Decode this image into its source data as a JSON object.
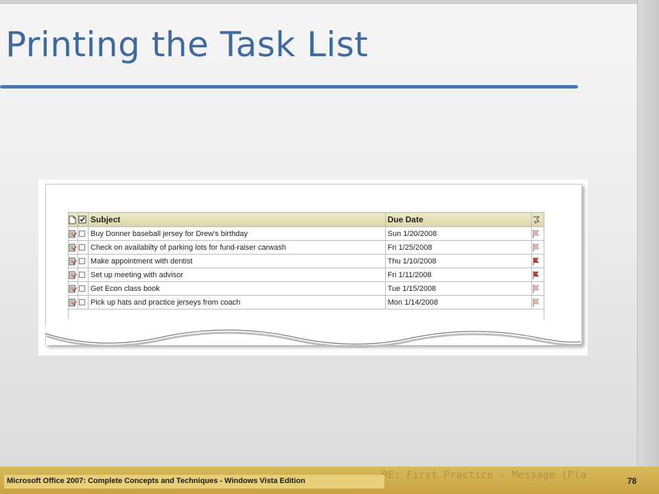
{
  "slide": {
    "title": "Printing the Task List",
    "footer": "Microsoft Office 2007: Complete Concepts and Techniques - Windows Vista Edition",
    "slide_number": "78",
    "footer_ghost_caption": "RE: First Practice - Message (Plain Te",
    "accent_color": "#3f6a9b",
    "footer_color": "#d4b052"
  },
  "task_table": {
    "columns": {
      "subject": "Subject",
      "due_date": "Due Date"
    },
    "rows": [
      {
        "subject": "Buy Donner baseball jersey for Drew's birthday",
        "due": "Sun 1/20/2008",
        "flag": "light"
      },
      {
        "subject": "Check on availabilty of parking lots for fund-raiser carwash",
        "due": "Fri 1/25/2008",
        "flag": "light"
      },
      {
        "subject": "Make appointment with dentist",
        "due": "Thu 1/10/2008",
        "flag": "dark"
      },
      {
        "subject": "Set up meeting with advisor",
        "due": "Fri 1/11/2008",
        "flag": "dark"
      },
      {
        "subject": "Get Econ class book",
        "due": "Tue 1/15/2008",
        "flag": "light"
      },
      {
        "subject": "Pick up hats and practice jerseys from coach",
        "due": "Mon 1/14/2008",
        "flag": "light"
      }
    ]
  },
  "icons": {
    "header": [
      "document-icon",
      "checkbox-icon",
      "flag-icon"
    ],
    "row": [
      "task-icon",
      "checkbox-icon",
      "flag-icon"
    ],
    "flag_light": "#e8b3b3",
    "flag_dark": "#c0392b"
  }
}
